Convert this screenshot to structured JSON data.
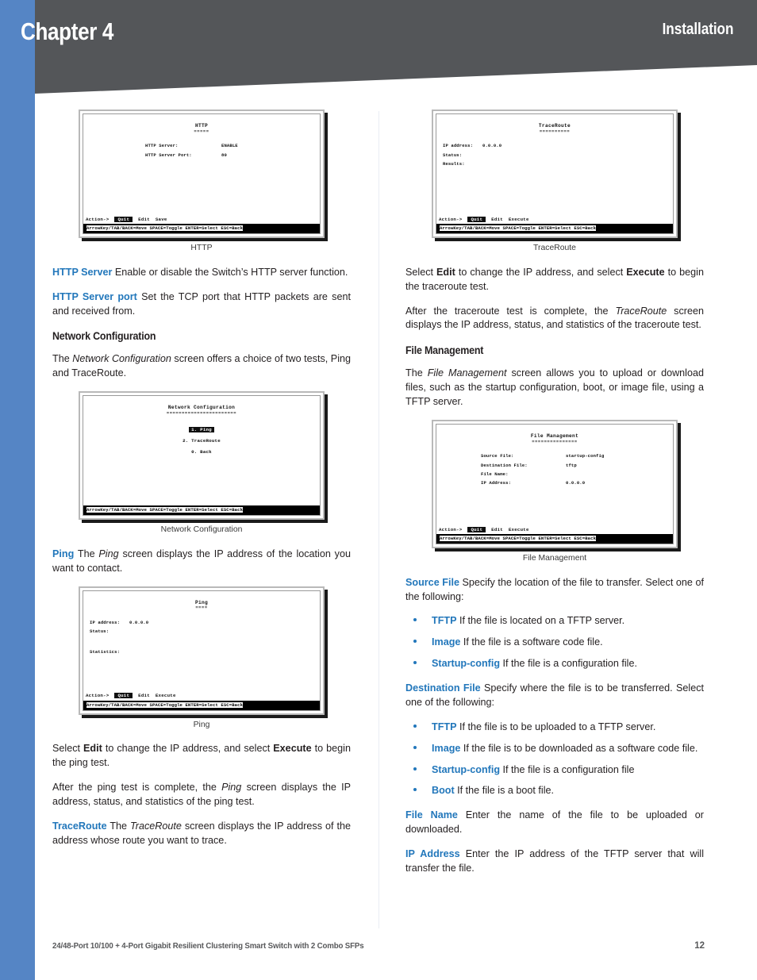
{
  "header": {
    "chapter": "Chapter 4",
    "section": "Installation"
  },
  "colors": {
    "spine": "#5585c5",
    "banner": "#545659",
    "term": "#2277bb"
  },
  "left_column": {
    "fig_http": {
      "caption": "HTTP",
      "title": "HTTP",
      "title_rule": "=====",
      "rows": [
        {
          "label": "HTTP Server:",
          "value": "ENABLE"
        },
        {
          "label": "HTTP Server Port:",
          "value": "80"
        }
      ],
      "action_prefix": "Action->",
      "action_selected": "Quit",
      "actions": [
        "Edit",
        "Save"
      ],
      "status": "ArrowKey/TAB/BACK=Move  SPACE=Toggle  ENTER=Select  ESC=Back"
    },
    "p_http_server": {
      "term": "HTTP Server",
      "text": " Enable or disable the Switch’s HTTP server function."
    },
    "p_http_port": {
      "term": "HTTP Server port",
      "text": " Set the TCP port that HTTP packets are sent and received from."
    },
    "subhead_network": "Network Configuration",
    "p_network_intro_1": "The ",
    "p_network_intro_italic": "Network Configuration",
    "p_network_intro_2": " screen offers a choice of two tests, Ping and TraceRoute.",
    "fig_netconf": {
      "caption": "Network Configuration",
      "title": "Network Configuration",
      "title_rule": "=======================",
      "menu": [
        {
          "text": "1. Ping",
          "selected": true
        },
        {
          "text": "2. TraceRoute",
          "selected": false
        },
        {
          "text": "0. Back",
          "selected": false
        }
      ],
      "status": "ArrowKey/TAB/BACK=Move  SPACE=Toggle  ENTER=Select  ESC=Back"
    },
    "p_ping": {
      "term": "Ping",
      "text_1": " The ",
      "italic": "Ping",
      "text_2": " screen displays the IP address of the location you want to contact."
    },
    "fig_ping": {
      "caption": "Ping",
      "title": "Ping",
      "title_rule": "====",
      "rows": [
        {
          "label": "IP address:",
          "value": "0.0.0.0"
        },
        {
          "label": "Status:",
          "value": ""
        },
        {
          "label": "",
          "value": ""
        },
        {
          "label": "Statistics:",
          "value": ""
        }
      ],
      "action_prefix": "Action->",
      "action_selected": "Quit",
      "actions": [
        "Edit",
        "Execute"
      ],
      "status": "ArrowKey/TAB/BACK=Move  SPACE=Toggle  ENTER=Select  ESC=Back"
    },
    "p_ping_edit": {
      "text_1": "Select ",
      "bold_1": "Edit",
      "text_2": " to change the IP address, and select ",
      "bold_2": "Execute",
      "text_3": " to begin the ping test."
    },
    "p_ping_after": {
      "text_1": "After the ping test is complete, the ",
      "italic": "Ping",
      "text_2": " screen displays the IP address, status, and statistics of the ping test."
    },
    "p_traceroute": {
      "term": "TraceRoute",
      "text_1": "  The ",
      "italic": "TraceRoute",
      "text_2": " screen displays the IP address of the address whose route you want to trace."
    }
  },
  "right_column": {
    "fig_traceroute": {
      "caption": "TraceRoute",
      "title": "TraceRoute",
      "title_rule": "==========",
      "rows": [
        {
          "label": "IP address:",
          "value": "0.0.0.0"
        },
        {
          "label": "Status:",
          "value": ""
        },
        {
          "label": "Results:",
          "value": ""
        }
      ],
      "action_prefix": "Action->",
      "action_selected": "Quit",
      "actions": [
        "Edit",
        "Execute"
      ],
      "status": "ArrowKey/TAB/BACK=Move  SPACE=Toggle  ENTER=Select  ESC=Back"
    },
    "p_tr_edit": {
      "text_1": "Select ",
      "bold_1": "Edit",
      "text_2": " to change the IP address, and select ",
      "bold_2": "Execute",
      "text_3": " to begin the traceroute test."
    },
    "p_tr_after": {
      "text_1": "After the traceroute test is complete, the ",
      "italic": "TraceRoute",
      "text_2": " screen displays the IP address, status, and statistics of the traceroute test."
    },
    "subhead_filemgmt": "File Management",
    "p_filemgmt_intro": {
      "text_1": "The ",
      "italic": "File Management",
      "text_2": " screen allows you to upload or download files, such as the startup configuration, boot, or image file, using a TFTP server."
    },
    "fig_filemgmt": {
      "caption": "File Management",
      "title": "File Management",
      "title_rule": "===============",
      "rows": [
        {
          "label": "Source File:",
          "value": "startup-config"
        },
        {
          "label": "Destination File:",
          "value": "tftp"
        },
        {
          "label": "File Name:",
          "value": ""
        },
        {
          "label": "IP Address:",
          "value": "0.0.0.0"
        }
      ],
      "action_prefix": "Action->",
      "action_selected": "Quit",
      "actions": [
        "Edit",
        "Execute"
      ],
      "status": "ArrowKey/TAB/BACK=Move  SPACE=Toggle  ENTER=Select  ESC=Back"
    },
    "p_source_file": {
      "term": "Source File",
      "text": " Specify the location of the file to transfer. Select one of the following:"
    },
    "source_bullets": [
      {
        "term": "TFTP",
        "text": "  If the file is located on a TFTP server."
      },
      {
        "term": "Image",
        "text": "  If the file is a software code file."
      },
      {
        "term": "Startup-config",
        "text": "  If the file is a configuration file."
      }
    ],
    "p_dest_file": {
      "term": "Destination File",
      "text": "  Specify where the file is to be transferred. Select one of the following:"
    },
    "dest_bullets": [
      {
        "term": "TFTP",
        "text": "  If the file is to be uploaded to a TFTP server."
      },
      {
        "term": "Image",
        "text": "  If the file is to be downloaded as a software code file."
      },
      {
        "term": "Startup-config",
        "text": "  If the file is a configuration file"
      },
      {
        "term": "Boot",
        "text": "  If the file is a boot file."
      }
    ],
    "p_file_name": {
      "term": "File Name",
      "text": "  Enter the name of the file to be uploaded or downloaded."
    },
    "p_ip_address": {
      "term": "IP Address",
      "text": "  Enter the IP address of the TFTP server that will transfer the file."
    }
  },
  "footer": {
    "text": "24/48-Port 10/100 + 4-Port Gigabit Resilient Clustering Smart Switch with 2 Combo SFPs",
    "page": "12"
  }
}
